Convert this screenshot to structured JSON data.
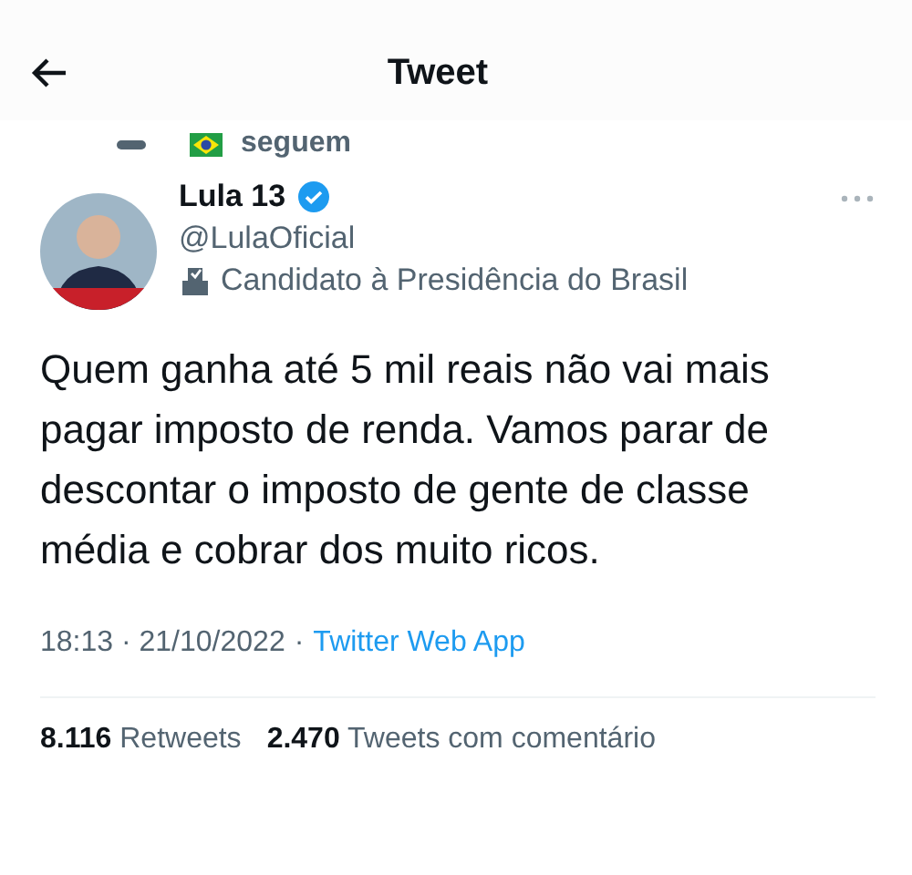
{
  "header": {
    "title": "Tweet"
  },
  "context": {
    "text": "seguem"
  },
  "author": {
    "name": "Lula 13",
    "verified": true,
    "handle": "@LulaOficial",
    "bio": "Candidato à Presidência do Brasil"
  },
  "tweet": {
    "text": "Quem ganha até 5 mil reais não vai mais pagar imposto de renda. Vamos parar de descontar o imposto de gente de classe média e cobrar dos muito ricos.",
    "time": "18:13",
    "date": "21/10/2022",
    "separator": "·",
    "source": "Twitter Web App"
  },
  "stats": [
    {
      "count": "8.116",
      "label": "Retweets"
    },
    {
      "count": "2.470",
      "label": "Tweets com comentário"
    }
  ]
}
